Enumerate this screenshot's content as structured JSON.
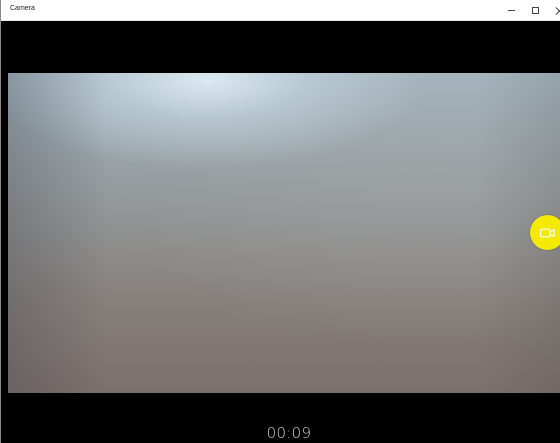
{
  "window": {
    "title": "Camera",
    "controls": {
      "minimize": "minimize",
      "maximize": "maximize",
      "close": "close"
    }
  },
  "camera": {
    "mode": "video",
    "record_button_icon": "video-camera-icon",
    "record_button_color": "#f4ea00",
    "elapsed_time": "00:09"
  },
  "colors": {
    "background": "#000000",
    "titlebar": "#ffffff",
    "accent": "#f4ea00",
    "timer_text": "#cfcfcf"
  }
}
